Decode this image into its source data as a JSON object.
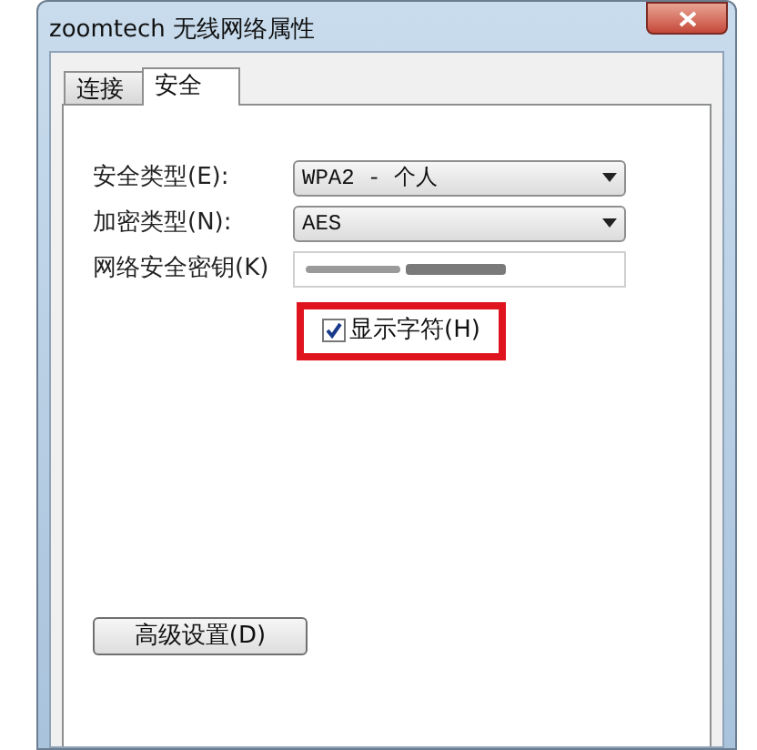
{
  "window": {
    "title": "zoomtech 无线网络属性"
  },
  "tabs": [
    {
      "label": "连接",
      "selected": false
    },
    {
      "label": "安全",
      "selected": true
    }
  ],
  "fields": [
    {
      "kind": "dropdown",
      "label": "安全类型(E):",
      "value": "WPA2 - 个人"
    },
    {
      "kind": "dropdown",
      "label": "加密类型(N):",
      "value": "AES"
    },
    {
      "kind": "masked",
      "label": "网络安全密钥(K)"
    }
  ],
  "show_characters": {
    "label": "显示字符(H)",
    "checked": true,
    "highlighted": true
  },
  "advanced_button": {
    "label": "高级设置(D)"
  }
}
